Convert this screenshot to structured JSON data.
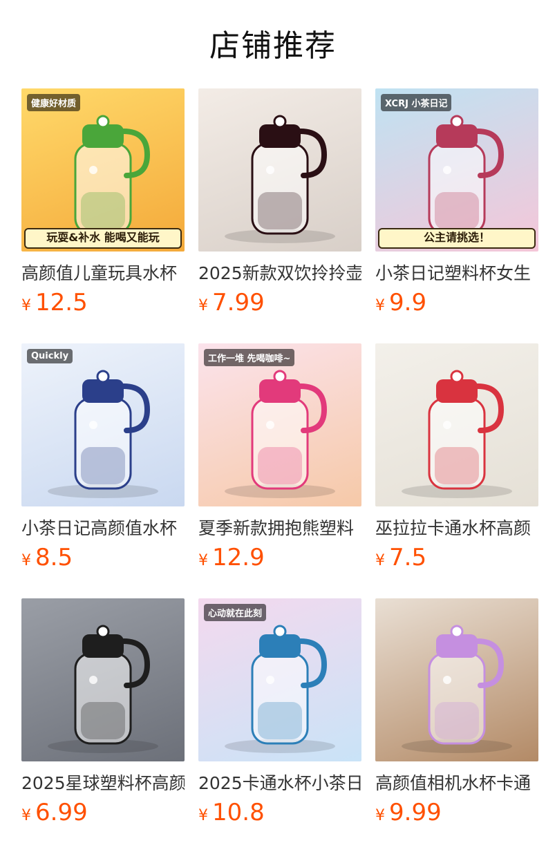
{
  "header": {
    "title": "店铺推荐"
  },
  "currency": "¥",
  "products": [
    {
      "name": "高颜值儿童玩具水杯",
      "price": "12.5",
      "bg": [
        "#ffd96a",
        "#f4a93a"
      ],
      "icon": "toy-bottle-icon",
      "overlay": "健康好材质",
      "banner": "玩耍&补水 能喝又能玩",
      "accent": "#4aa63a"
    },
    {
      "name": "2025新款双饮拎拎壶",
      "price": "7.99",
      "bg": [
        "#f3ece6",
        "#d8cfc8"
      ],
      "icon": "kettle-bottle-icon",
      "overlay": "",
      "banner": "",
      "accent": "#2a0f14"
    },
    {
      "name": "小茶日记塑料杯女生",
      "price": "9.9",
      "bg": [
        "#bfe2f2",
        "#f5c6d8"
      ],
      "icon": "straw-cup-icon",
      "overlay": "XCRJ 小茶日记",
      "banner": "公主请挑选！",
      "accent": "#b63a5a"
    },
    {
      "name": "小茶日记高颜值水杯",
      "price": "8.5",
      "bg": [
        "#eef3fb",
        "#c9d8f0"
      ],
      "icon": "sport-bottle-icon",
      "overlay": "Quickly",
      "banner": "",
      "accent": "#2b3f8a"
    },
    {
      "name": "夏季新款拥抱熊塑料",
      "price": "12.9",
      "bg": [
        "#fbe3ec",
        "#f6c9a8"
      ],
      "icon": "bear-cup-icon",
      "overlay": "工作一堆 先喝咖啡~",
      "banner": "",
      "accent": "#e23a7b"
    },
    {
      "name": "巫拉拉卡通水杯高颜",
      "price": "7.5",
      "bg": [
        "#f3f0ea",
        "#e5e0d6"
      ],
      "icon": "cartoon-bottle-icon",
      "overlay": "",
      "banner": "",
      "accent": "#d9333f"
    },
    {
      "name": "2025星球塑料杯高颜",
      "price": "6.99",
      "bg": [
        "#9a9ea6",
        "#6c7079"
      ],
      "icon": "clear-bottle-icon",
      "overlay": "",
      "banner": "",
      "accent": "#1e1e1e"
    },
    {
      "name": "2025卡通水杯小茶日",
      "price": "10.8",
      "bg": [
        "#f4d9ee",
        "#c9e3f7"
      ],
      "icon": "kids-bottle-icon",
      "overlay": "心动就在此刻",
      "banner": "",
      "accent": "#2c7fb8"
    },
    {
      "name": "高颜值相机水杯卡通",
      "price": "9.99",
      "bg": [
        "#e9dfd4",
        "#b38a66"
      ],
      "icon": "camera-bottle-icon",
      "overlay": "",
      "banner": "",
      "accent": "#c58fe0"
    }
  ]
}
